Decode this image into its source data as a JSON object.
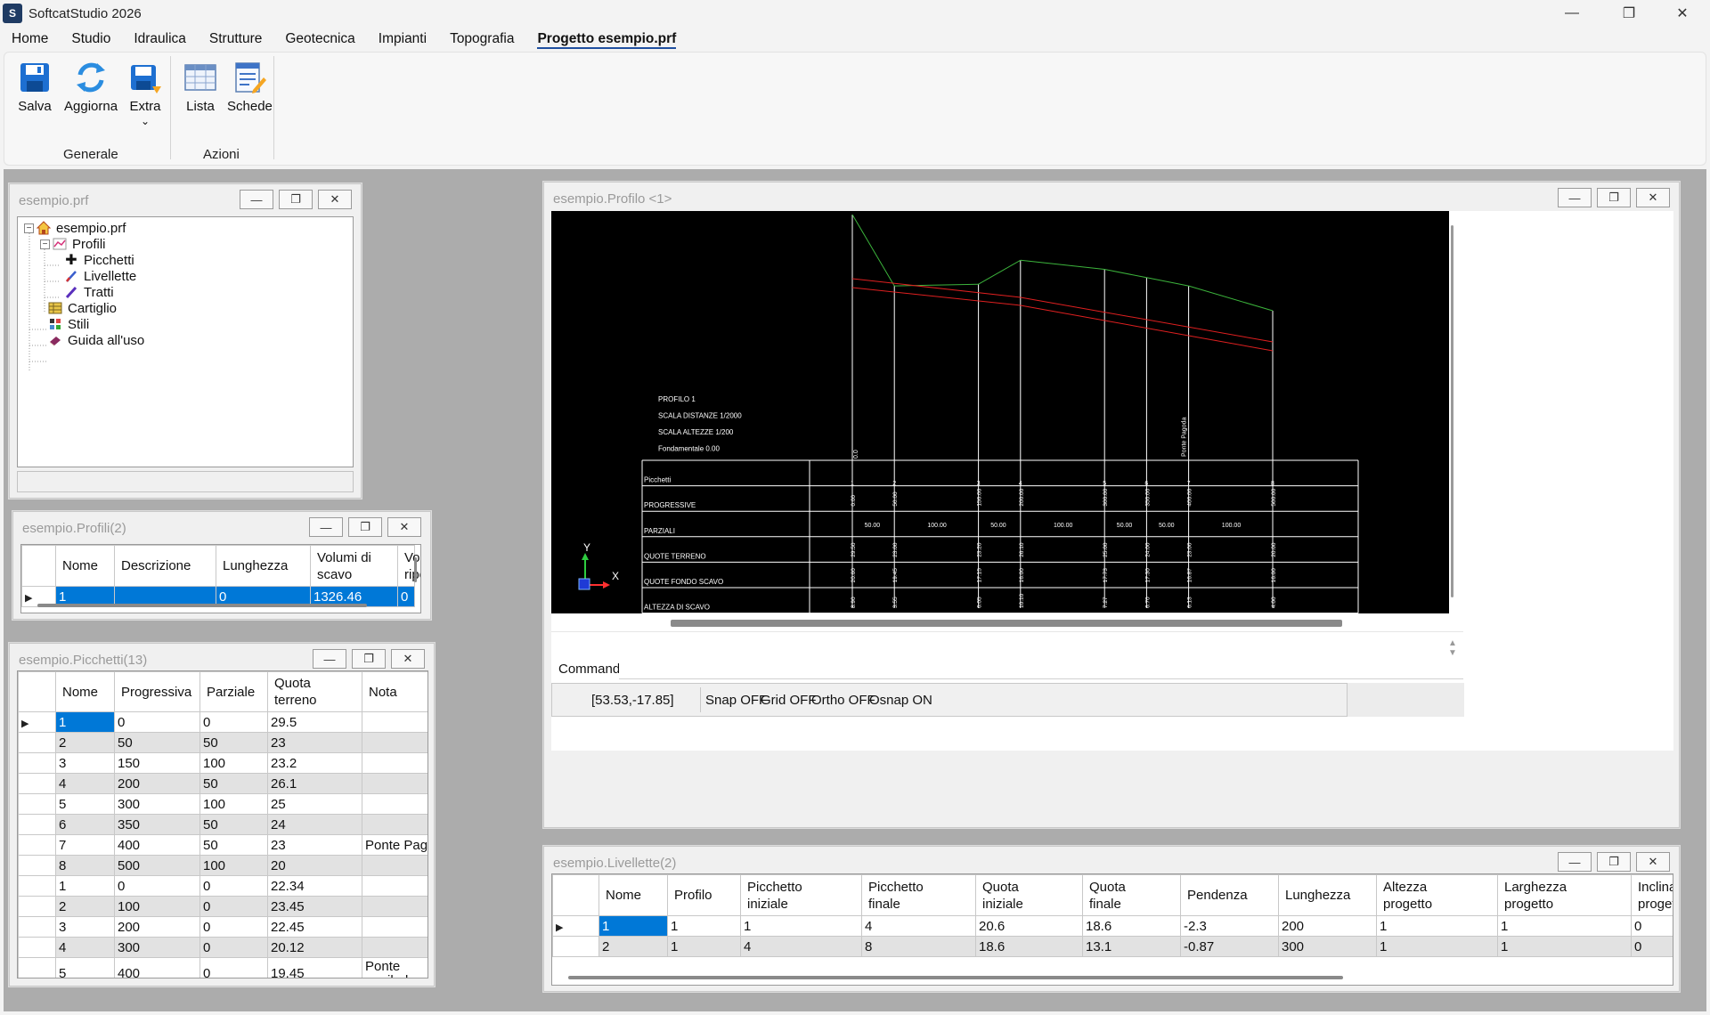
{
  "app": {
    "title": "SoftcatStudio 2026"
  },
  "menu": [
    "Home",
    "Studio",
    "Idraulica",
    "Strutture",
    "Geotecnica",
    "Impianti",
    "Topografia",
    "Progetto esempio.prf"
  ],
  "ribbon": {
    "buttons": {
      "salva": "Salva",
      "aggiorna": "Aggiorna",
      "extra": "Extra",
      "lista": "Lista",
      "schede": "Schede"
    },
    "groups": {
      "generale": "Generale",
      "azioni": "Azioni"
    }
  },
  "tree_window": {
    "title": "esempio.prf",
    "nodes": {
      "root": "esempio.prf",
      "profili": "Profili",
      "picchetti": "Picchetti",
      "livellette": "Livellette",
      "tratti": "Tratti",
      "cartiglio": "Cartiglio",
      "stili": "Stili",
      "guida": "Guida all'uso"
    }
  },
  "profili_window": {
    "title": "esempio.Profili(2)",
    "columns": [
      "Nome",
      "Descrizione",
      "Lunghezza",
      "Volumi di scavo",
      "Volumi di riporto"
    ],
    "rows": [
      [
        "1",
        "",
        "0",
        "1326.46",
        "0"
      ]
    ]
  },
  "picchetti_window": {
    "title": "esempio.Picchetti(13)",
    "columns": [
      "Nome",
      "Progressiva",
      "Parziale",
      "Quota terreno",
      "Nota"
    ],
    "rows": [
      [
        "1",
        "0",
        "0",
        "29.5",
        ""
      ],
      [
        "2",
        "50",
        "50",
        "23",
        ""
      ],
      [
        "3",
        "150",
        "100",
        "23.2",
        ""
      ],
      [
        "4",
        "200",
        "50",
        "26.1",
        ""
      ],
      [
        "5",
        "300",
        "100",
        "25",
        ""
      ],
      [
        "6",
        "350",
        "50",
        "24",
        ""
      ],
      [
        "7",
        "400",
        "50",
        "23",
        "Ponte Pagoda"
      ],
      [
        "8",
        "500",
        "100",
        "20",
        ""
      ],
      [
        "1",
        "0",
        "0",
        "22.34",
        ""
      ],
      [
        "2",
        "100",
        "0",
        "23.45",
        ""
      ],
      [
        "3",
        "200",
        "0",
        "22.45",
        ""
      ],
      [
        "4",
        "300",
        "0",
        "20.12",
        ""
      ],
      [
        "5",
        "400",
        "0",
        "19.45",
        "Ponte annibale"
      ]
    ]
  },
  "profilo_window": {
    "title": "esempio.Profilo <1>",
    "cad": {
      "info": [
        "PROFILO 1",
        "SCALA DISTANZE 1/2000",
        "SCALA ALTEZZE 1/200",
        "Fondamentale 0.00"
      ],
      "row_labels": [
        "Picchetti",
        "PROGRESSIVE",
        "PARZIALI",
        "QUOTE TERRENO",
        "QUOTE FONDO SCAVO",
        "ALTEZZA DI SCAVO"
      ],
      "station_names": [
        "1",
        "2",
        "3",
        "4",
        "5",
        "6",
        "7",
        "8"
      ],
      "progressive": [
        "0.00",
        "50.00",
        "150.00",
        "200.00",
        "300.00",
        "350.00",
        "400.00",
        "500.00"
      ],
      "parziali": [
        "50.00",
        "100.00",
        "50.00",
        "100.00",
        "50.00",
        "50.00",
        "100.00"
      ],
      "quote_terreno": [
        "29.50",
        "23.00",
        "23.20",
        "26.10",
        "25.00",
        "24.00",
        "23.00",
        "20.00"
      ],
      "quote_fondo": [
        "20.60",
        "19.45",
        "17.15",
        "16.00",
        "17.73",
        "17.30",
        "16.87",
        "16.00"
      ],
      "altezza_scavo": [
        "8.90",
        "3.55",
        "6.05",
        "10.10",
        "7.27",
        "6.70",
        "6.13",
        "4.00"
      ],
      "station_note": "Ponte Pagoda",
      "station_note_1": "0.0",
      "axis": {
        "x": "X",
        "y": "Y"
      }
    },
    "command_label": "Command:",
    "status": {
      "coords": "[53.53,-17.85]",
      "snap": "Snap OFF",
      "grid": "Grid OFF",
      "ortho": "Ortho OFF",
      "osnap": "Osnap ON"
    }
  },
  "livellette_window": {
    "title": "esempio.Livellette(2)",
    "columns": [
      "Nome",
      "Profilo",
      "Picchetto iniziale",
      "Picchetto finale",
      "Quota iniziale",
      "Quota finale",
      "Pendenza",
      "Lunghezza",
      "Altezza progetto",
      "Larghezza progetto",
      "Inclina proget"
    ],
    "rows": [
      [
        "1",
        "1",
        "1",
        "4",
        "20.6",
        "18.6",
        "-2.3",
        "200",
        "1",
        "1",
        "0"
      ],
      [
        "2",
        "1",
        "4",
        "8",
        "18.6",
        "13.1",
        "-0.87",
        "300",
        "1",
        "1",
        "0"
      ]
    ]
  }
}
